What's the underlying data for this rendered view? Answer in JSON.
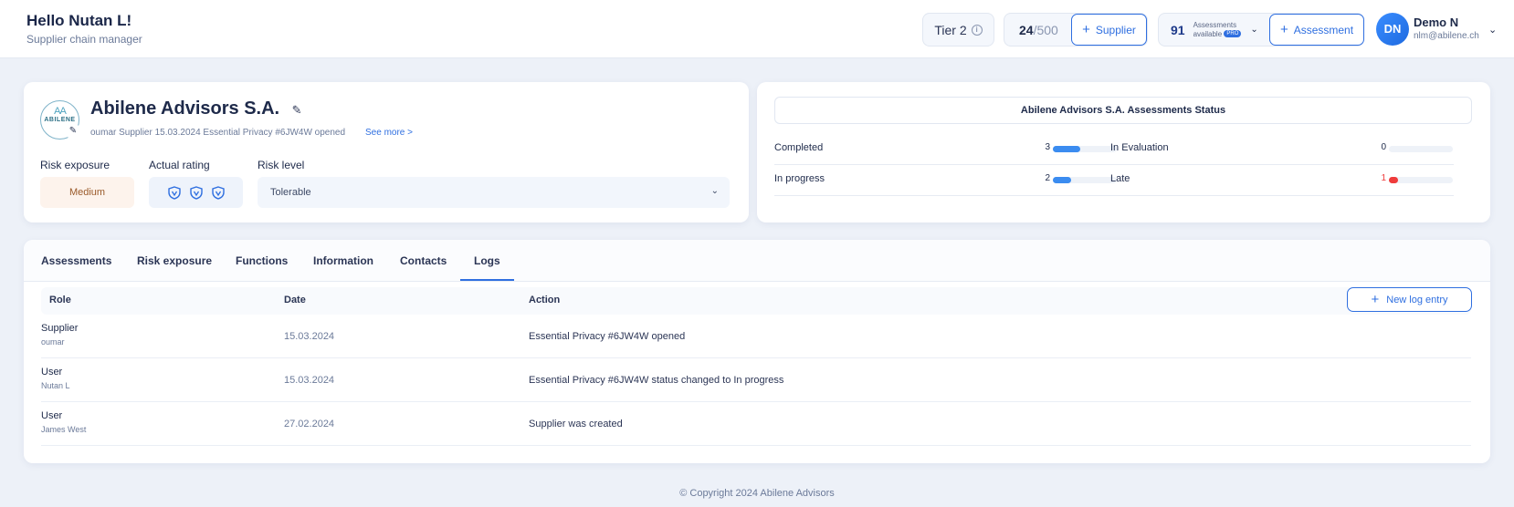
{
  "header": {
    "greeting": "Hello Nutan L!",
    "role": "Supplier chain manager",
    "tier_label": "Tier 2",
    "supplier_count": "24",
    "supplier_total": "/500",
    "supplier_button": "Supplier",
    "assessments_count": "91",
    "assessments_text": "Assessments",
    "available_text": "available",
    "pro_badge": "PRO",
    "assessment_button": "Assessment",
    "avatar_initials": "DN",
    "user_name": "Demo N",
    "user_email": "nlm@abilene.ch"
  },
  "supplier": {
    "logo_text": "ABILENE",
    "logo_mark": "AA",
    "name": "Abilene Advisors S.A.",
    "meta": "oumar Supplier 15.03.2024 Essential Privacy #6JW4W opened",
    "see_more": "See more >",
    "risk_exposure_label": "Risk exposure",
    "risk_exposure_value": "Medium",
    "rating_label": "Actual rating",
    "rating_shields": 3,
    "risk_level_label": "Risk level",
    "risk_level_value": "Tolerable"
  },
  "status": {
    "title": "Abilene Advisors S.A. Assessments Status",
    "items": [
      {
        "label": "Completed",
        "value": "3",
        "fraction": 0.43,
        "color": "#3b8cf0"
      },
      {
        "label": "In Evaluation",
        "value": "0",
        "fraction": 0,
        "color": "#3b8cf0"
      },
      {
        "label": "In progress",
        "value": "2",
        "fraction": 0.29,
        "color": "#3b8cf0"
      },
      {
        "label": "Late",
        "value": "1",
        "fraction": 0.14,
        "color": "#ef3b3b"
      }
    ]
  },
  "tabs": [
    "Assessments",
    "Risk exposure",
    "Functions",
    "Information",
    "Contacts",
    "Logs"
  ],
  "active_tab": "Logs",
  "table": {
    "columns": [
      "Role",
      "Date",
      "Action"
    ],
    "new_button": "New log entry",
    "rows": [
      {
        "role": "Supplier",
        "who": "oumar",
        "date": "15.03.2024",
        "action": "Essential Privacy #6JW4W opened"
      },
      {
        "role": "User",
        "who": "Nutan L",
        "date": "15.03.2024",
        "action": "Essential Privacy #6JW4W status changed to In progress"
      },
      {
        "role": "User",
        "who": "James West",
        "date": "27.02.2024",
        "action": "Supplier was created"
      }
    ]
  },
  "footer": "© Copyright 2024 Abilene Advisors"
}
